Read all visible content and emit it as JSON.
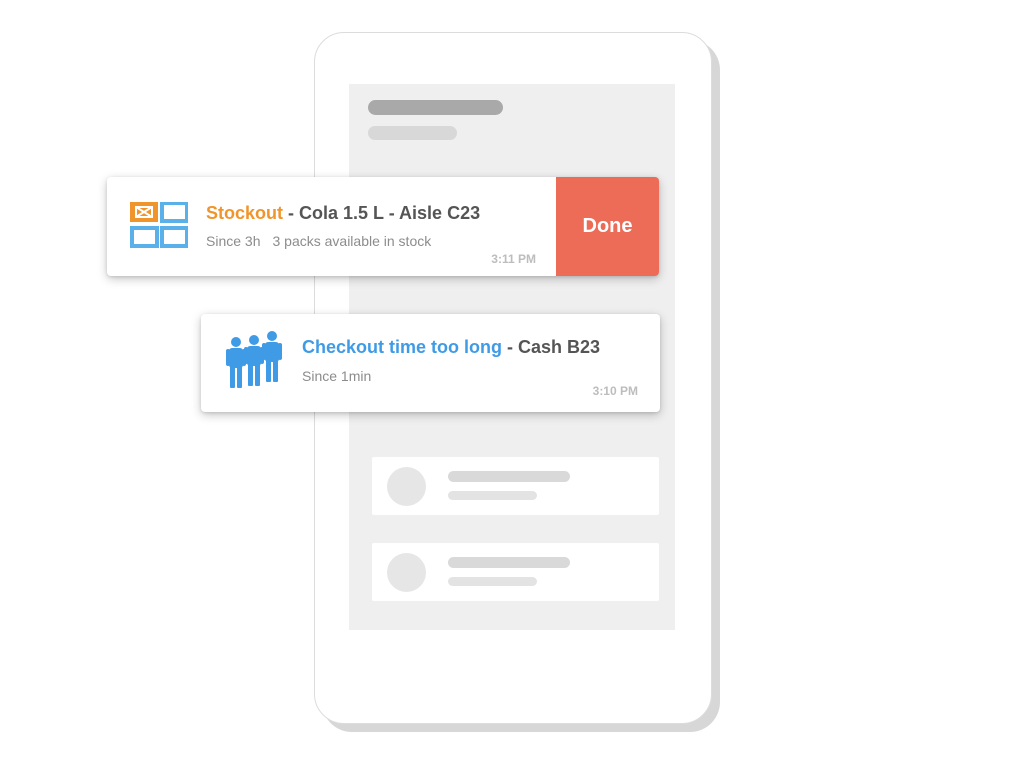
{
  "colors": {
    "stockout_accent": "#f0952b",
    "checkout_accent": "#3f9be6",
    "done_button": "#ec6c57",
    "title_text": "#555555"
  },
  "notifications": [
    {
      "icon": "shelf-grid-icon",
      "category": "Stockout",
      "separator": " - ",
      "detail": "Cola 1.5 L - Aisle C23",
      "since": "Since 3h",
      "note": "3 packs available in stock",
      "time": "3:11 PM",
      "action_label": "Done"
    },
    {
      "icon": "queue-people-icon",
      "category": "Checkout time too long",
      "separator": " - ",
      "detail": "Cash B23",
      "since": "Since 1min",
      "time": "3:10 PM"
    }
  ]
}
